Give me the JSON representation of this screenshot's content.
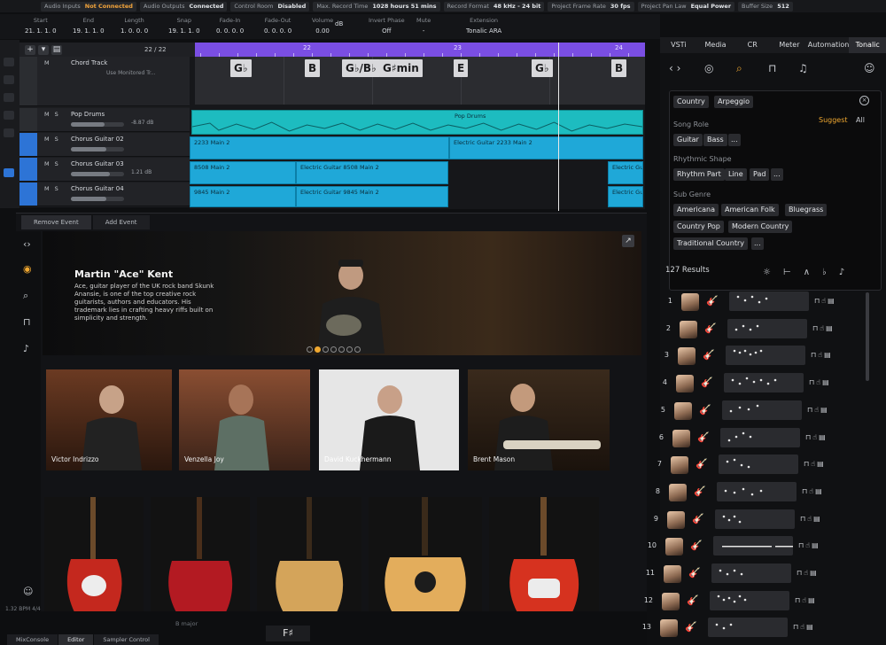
{
  "status_bar": [
    {
      "label": "Audio Inputs",
      "value": "Not Connected",
      "warn": true
    },
    {
      "label": "Audio Outputs",
      "value": "Connected"
    },
    {
      "label": "Control Room",
      "value": "Disabled"
    },
    {
      "label": "Max. Record Time",
      "value": "1028 hours 51 mins"
    },
    {
      "label": "Record Format",
      "value": "48 kHz - 24 bit"
    },
    {
      "label": "Project Frame Rate",
      "value": "30 fps"
    },
    {
      "label": "Project Pan Law",
      "value": "Equal Power"
    },
    {
      "label": "Buffer Size",
      "value": "512"
    }
  ],
  "info_line": [
    {
      "label": "Start",
      "value": "21. 1. 1. 0"
    },
    {
      "label": "End",
      "value": "19. 1. 1. 0"
    },
    {
      "label": "Length",
      "value": "1. 0. 0. 0"
    },
    {
      "label": "Snap",
      "value": "19. 1. 1. 0"
    },
    {
      "label": "Fade-In",
      "value": "0. 0. 0. 0"
    },
    {
      "label": "Fade-Out",
      "value": "0. 0. 0. 0"
    },
    {
      "label": "Volume",
      "value": "0.00"
    },
    {
      "label": "",
      "value": "dB"
    },
    {
      "label": "Invert Phase",
      "value": "Off"
    },
    {
      "label": "Mute",
      "value": "-"
    },
    {
      "label": "Extension",
      "value": "Tonalic ARA"
    }
  ],
  "arrange": {
    "zoom": "22 / 22",
    "ruler_bars": [
      "22",
      "23",
      "24"
    ],
    "chords": [
      "G♭",
      "B",
      "G♭/B♭",
      "G♯min",
      "E",
      "G♭",
      "B"
    ],
    "tracks": [
      {
        "name": "Chord Track",
        "sub": "Use Monitored Tr..."
      },
      {
        "name": "Pop Drums",
        "db": "-8.87 dB"
      },
      {
        "name": "Chorus Guitar 02",
        "db": ""
      },
      {
        "name": "Chorus Guitar 03",
        "db": "1.21 dB"
      },
      {
        "name": "Chorus Guitar 04",
        "db": ""
      }
    ],
    "clips": [
      "Pop Drums",
      "2233 Main 2",
      "Electric Guitar 2233 Main 2",
      "8508 Main 2",
      "Electric Guitar 8508 Main 2",
      "Electric Gu",
      "9845 Main 2",
      "Electric Guitar 9845 Main 2",
      "Electric Gu"
    ]
  },
  "lower": {
    "tabs": [
      "Remove Event",
      "Add Event"
    ],
    "hero_title": "Martin \"Ace\" Kent",
    "hero_desc": "Ace, guitar player of the UK rock band Skunk Anansie, is one of the top creative rock guitarists, authors and educators. His trademark lies in crafting heavy riffs built on simplicity and strength.",
    "artists": [
      "Victor Indrizzo",
      "Venzella Joy",
      "David Kuckhermann",
      "Brent Mason"
    ],
    "bottom_tabs": [
      "MixConsole",
      "Editor",
      "Sampler Control"
    ],
    "key": "F♯",
    "key_hint": "B major",
    "tempo": "1.32 BPM  4/4"
  },
  "right_panel": {
    "tabs": [
      "VSTi",
      "Media",
      "CR",
      "Meter",
      "Automation",
      "Tonalic"
    ],
    "active_filters": [
      "Country",
      "Arpeggio"
    ],
    "suggest_label": "Suggest",
    "all_label": "All",
    "song_role": {
      "title": "Song Role",
      "chips": [
        "Guitar",
        "Bass",
        "..."
      ]
    },
    "rhythmic_shape": {
      "title": "Rhythmic Shape",
      "chips": [
        "Rhythm Part",
        "Line",
        "Pad",
        "..."
      ]
    },
    "sub_genre": {
      "title": "Sub Genre",
      "chips": [
        "Americana",
        "American Folk",
        "Bluegrass",
        "Country Pop",
        "Modern Country",
        "Traditional Country",
        "..."
      ]
    },
    "results_label": "127 Results",
    "rows": [
      "1",
      "2",
      "3",
      "4",
      "5",
      "6",
      "7",
      "8",
      "9",
      "10",
      "11",
      "12",
      "13"
    ]
  }
}
